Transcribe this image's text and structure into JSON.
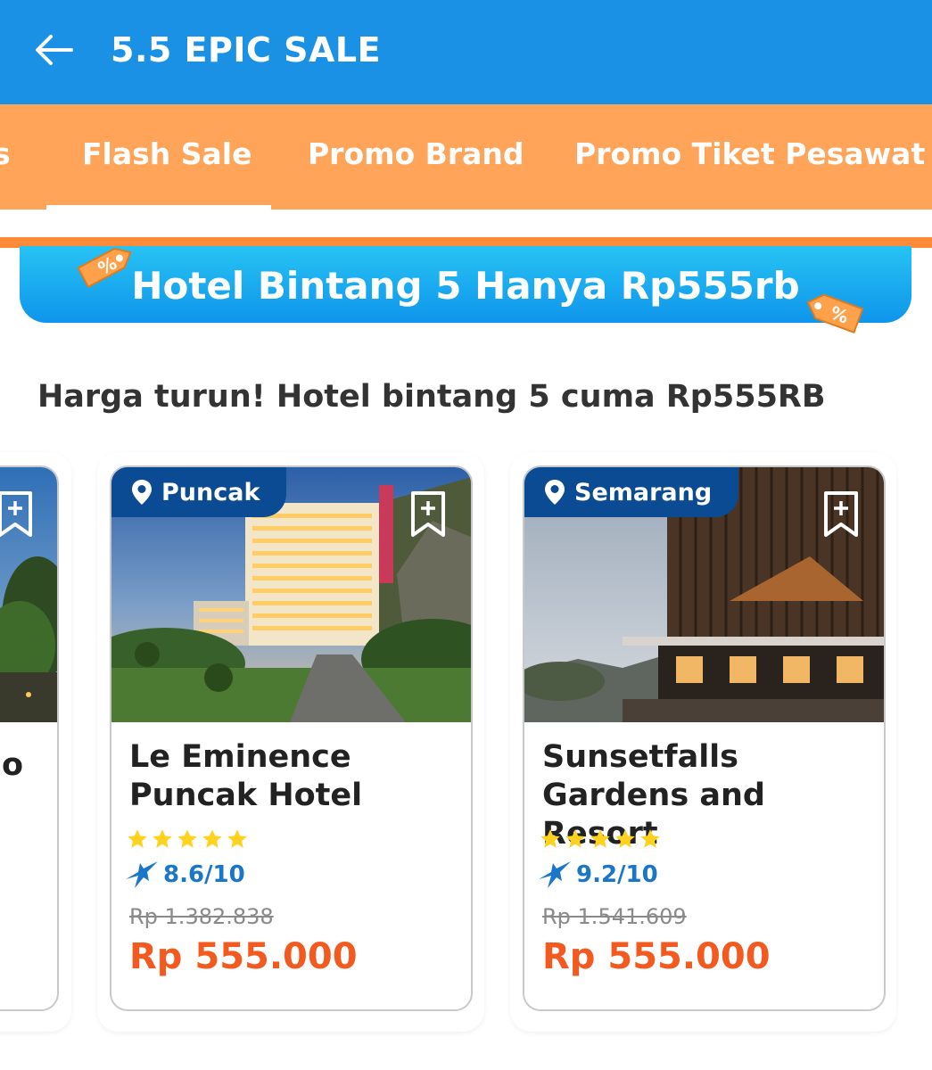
{
  "header": {
    "title": "5.5 EPIC SALE",
    "back_icon": "arrow-left-icon"
  },
  "tabs": [
    {
      "label": "s"
    },
    {
      "label": "Flash Sale",
      "selected": true
    },
    {
      "label": "Promo Brand"
    },
    {
      "label": "Promo Tiket Pesawat"
    }
  ],
  "banner": {
    "text": "Hotel Bintang 5 Hanya Rp555rb"
  },
  "section": {
    "title": "Harga turun! Hotel bintang 5 cuma Rp555RB"
  },
  "partial_card": {
    "name_fragment": "o"
  },
  "hotels": [
    {
      "location": "Puncak",
      "name_line1": "Le Eminence",
      "name_line2": "Puncak Hotel",
      "stars": 5,
      "rating": "8.6/10",
      "original_price": "Rp 1.382.838",
      "price": "Rp 555.000"
    },
    {
      "location": "Semarang",
      "name_line1": "Sunsetfalls",
      "name_line2": "Gardens and Resort",
      "stars": 5,
      "rating": "9.2/10",
      "original_price": "Rp 1.541.609",
      "price": "Rp 555.000"
    }
  ],
  "colors": {
    "appbar": "#1a91e4",
    "tabbar": "#ffa458",
    "location_badge": "#0b4b94",
    "price": "#f25a1f",
    "rating": "#1a76c8",
    "star": "#ffd21f"
  }
}
